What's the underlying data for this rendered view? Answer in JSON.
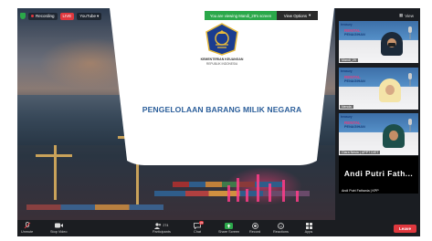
{
  "meeting": {
    "recording_label": "Recording",
    "live_label": "LIVE",
    "youtube_label": "YouTube",
    "banner_text": "You are viewing Mandi_29's screen",
    "view_options_label": "View Options",
    "view_label": "View"
  },
  "slide": {
    "logo_caption_1": "KEMENTERIAN KEUANGAN",
    "logo_caption_2": "REPUBLIK INDONESIA",
    "title": "PENGELOLAAN BARANG MILIK NEGARA"
  },
  "participants": [
    {
      "head": "treasury",
      "tag1": "RENTAL",
      "tag2": "PENAGIHAN",
      "name": "Mandi_29",
      "skin": "#c9956e",
      "hijab": "#1c2a3a"
    },
    {
      "head": "treasury",
      "tag1": "RENTAL",
      "tag2": "PENAGIHAN",
      "name": "Nenda",
      "skin": "#d7a985",
      "hijab": "#f4e4a8"
    },
    {
      "head": "treasury",
      "tag1": "RENTAL",
      "tag2": "PENAGIHAN",
      "name": "Clara Nesia | UPPT D/ET",
      "skin": "#c48e66",
      "hijab": "#1d4f4a"
    }
  ],
  "featured": {
    "big_name": "Andi Putri Fath...",
    "label": "Andi Putri Fathania | KPP"
  },
  "toolbar": {
    "unmute": "Unmute",
    "stop_video": "Stop Video",
    "participants": "Participants",
    "participants_count": "274",
    "chat": "Chat",
    "chat_badge": "23",
    "share_screen": "Share Screen",
    "record": "Record",
    "reactions": "Reactions",
    "apps": "Apps",
    "leave": "Leave"
  },
  "colors": {
    "accent_green": "#2ba84a",
    "leave_red": "#e0383e",
    "slide_title_blue": "#2b5e9a"
  }
}
